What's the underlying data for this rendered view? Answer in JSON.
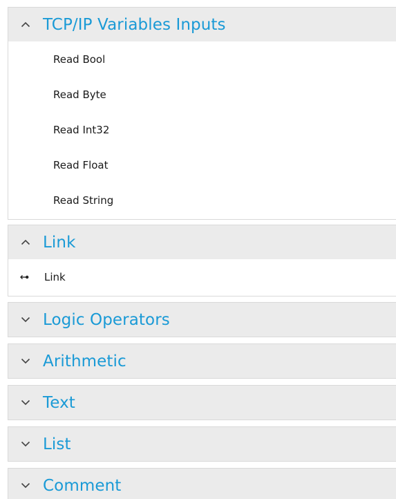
{
  "sections": [
    {
      "title": "TCP/IP Variables Inputs",
      "state": "expanded",
      "icon": "chevron-up-icon",
      "items": [
        "Read Bool",
        "Read Byte",
        "Read Int32",
        "Read Float",
        "Read String"
      ]
    },
    {
      "title": "Link",
      "state": "expanded",
      "icon": "chevron-up-icon",
      "items": [
        {
          "label": "Link",
          "icon": "link-arrows-icon"
        }
      ]
    },
    {
      "title": "Logic Operators",
      "state": "collapsed",
      "icon": "chevron-down-icon"
    },
    {
      "title": "Arithmetic",
      "state": "collapsed",
      "icon": "chevron-down-icon"
    },
    {
      "title": "Text",
      "state": "collapsed",
      "icon": "chevron-down-icon"
    },
    {
      "title": "List",
      "state": "collapsed",
      "icon": "chevron-down-icon"
    },
    {
      "title": "Comment",
      "state": "collapsed",
      "icon": "chevron-down-icon"
    }
  ],
  "colors": {
    "header_text": "#1a9ad6",
    "header_bg": "#ebebeb",
    "item_text": "#1a1a1a",
    "border": "#d9d9d9"
  }
}
